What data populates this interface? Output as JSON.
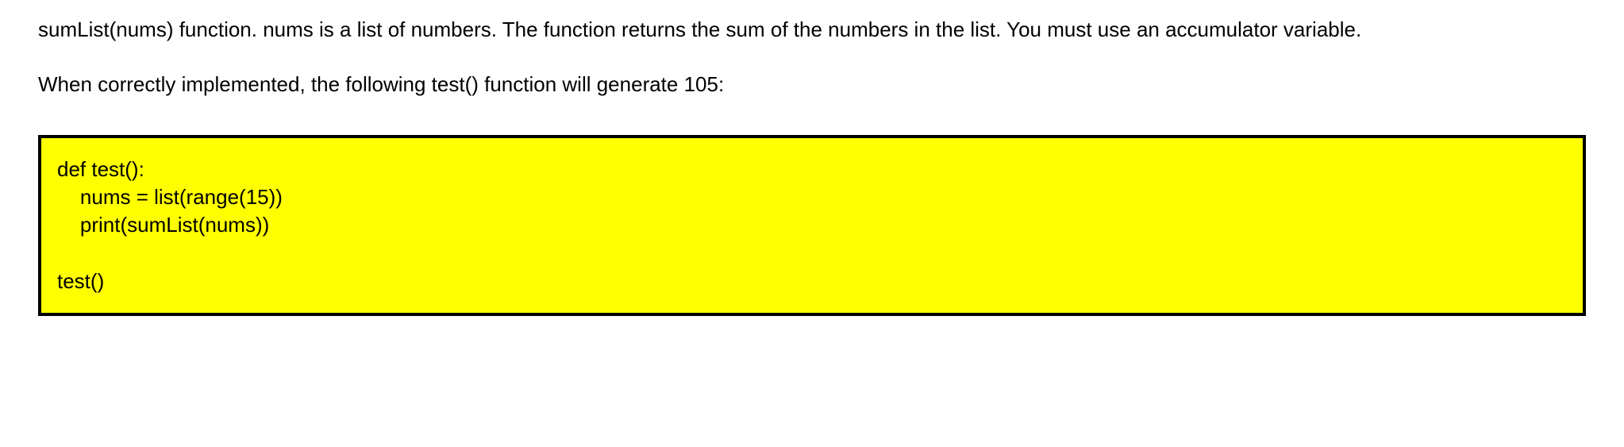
{
  "paragraph1": "sumList(nums) function. nums is a list of numbers. The function returns the sum of the numbers in the list. You must use an accumulator variable.",
  "paragraph2": "When correctly implemented, the following test() function will generate 105:",
  "code": "def test():\n    nums = list(range(15))\n    print(sumList(nums))\n\ntest()"
}
